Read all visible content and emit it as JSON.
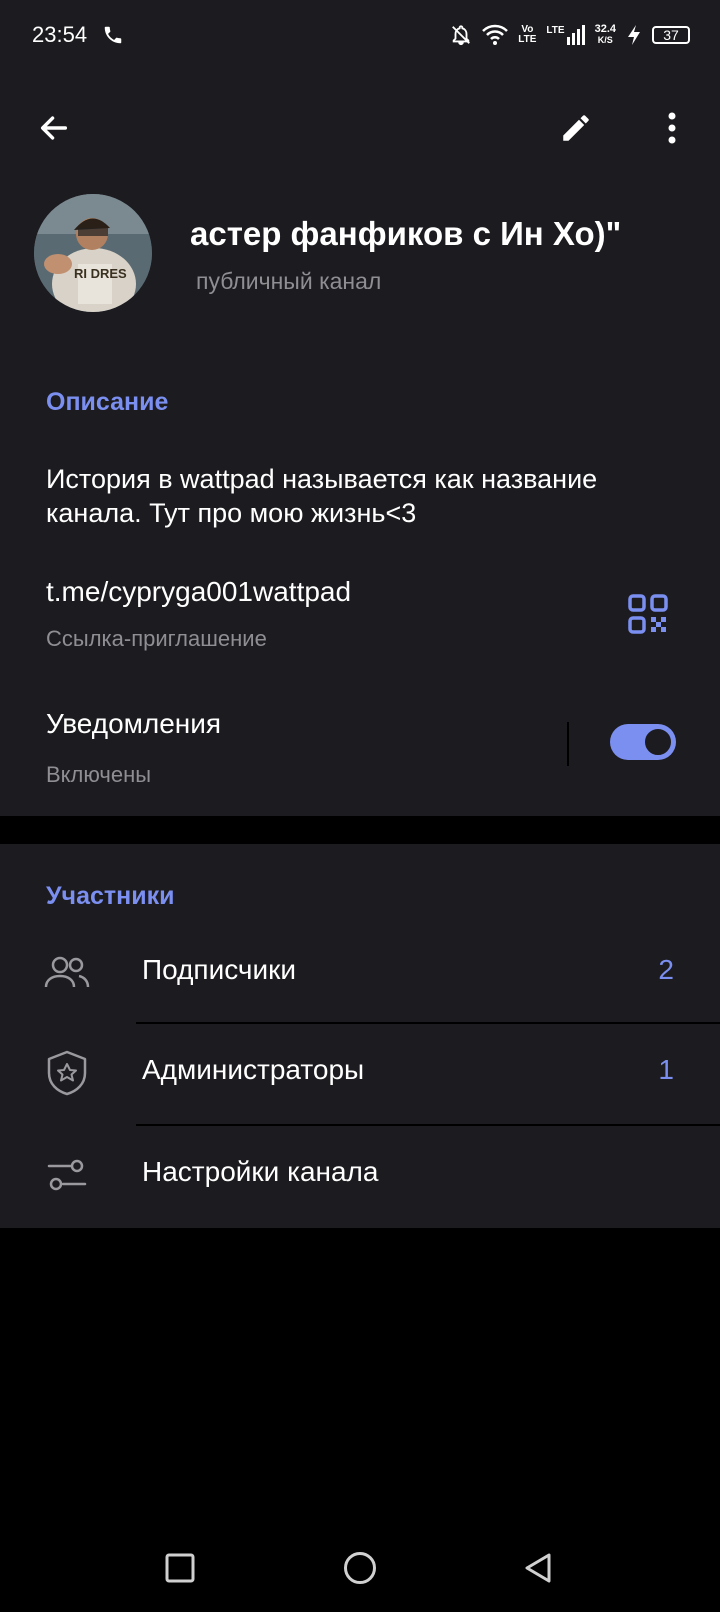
{
  "status_bar": {
    "time": "23:54",
    "network": "LTE",
    "speed_value": "32.4",
    "speed_unit": "K/S",
    "battery": "37"
  },
  "header": {
    "back_icon": "arrow-left-icon",
    "edit_icon": "pencil-icon",
    "more_icon": "more-vertical-icon",
    "title": "астер фанфиков с Ин Хо)\"",
    "subtitle": "публичный канал"
  },
  "info": {
    "section_title": "Описание",
    "description": "История в wattpad называется как название канала. Тут про мою жизнь<3",
    "link": "t.me/cypryga001wattpad",
    "link_caption": "Ссылка-приглашение",
    "notifications_label": "Уведомления",
    "notifications_state": "Включены",
    "notifications_on": true
  },
  "members": {
    "section_title": "Участники",
    "rows": [
      {
        "label": "Подписчики",
        "count": "2",
        "icon": "users-icon"
      },
      {
        "label": "Администраторы",
        "count": "1",
        "icon": "shield-star-icon"
      },
      {
        "label": "Настройки канала",
        "count": "",
        "icon": "sliders-icon"
      }
    ]
  },
  "colors": {
    "accent": "#7b8ff0",
    "surface": "#1c1b1f",
    "background": "#000000",
    "secondary_text": "#8e8e93"
  }
}
